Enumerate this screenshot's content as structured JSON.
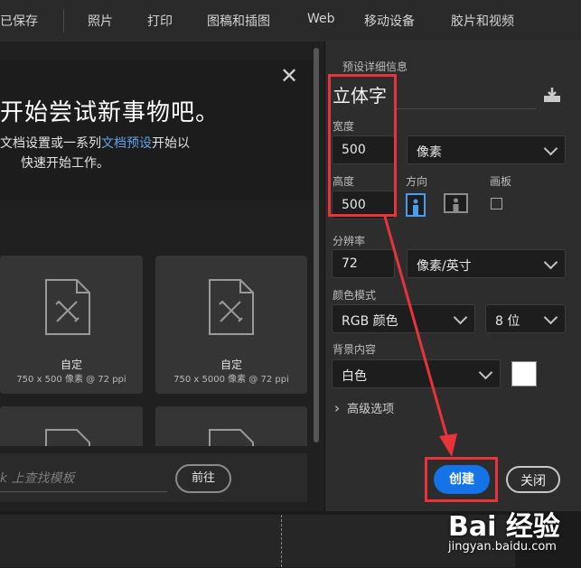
{
  "tabs": [
    "已保存",
    "照片",
    "打印",
    "图稿和插图",
    "Web",
    "移动设备",
    "胶片和视频"
  ],
  "intro": {
    "title": "开始尝试新事物吧。",
    "line1_pre": "文档设置或一系列",
    "line1_link": "文档预设",
    "line1_post": "开始以",
    "line2": "快速开始工作。"
  },
  "presets": [
    {
      "name": "自定",
      "size": "750 x 500 像素 @ 72 ppi"
    },
    {
      "name": "自定",
      "size": "750 x 5000 像素 @ 72 ppi"
    }
  ],
  "search": {
    "placeholder": "k 上查找模板",
    "go_label": "前往"
  },
  "details": {
    "section_title": "预设详细信息",
    "preset_name": "立体字",
    "width_label": "宽度",
    "width_value": "500",
    "unit_value": "像素",
    "height_label": "高度",
    "height_value": "500",
    "orientation_label": "方向",
    "artboard_label": "画板",
    "resolution_label": "分辨率",
    "resolution_value": "72",
    "resolution_unit": "像素/英寸",
    "color_mode_label": "颜色模式",
    "color_mode_value": "RGB 颜色",
    "bit_depth_value": "8 位",
    "background_label": "背景内容",
    "background_value": "白色",
    "advanced_label": "高级选项",
    "background_swatch": "#ffffff"
  },
  "actions": {
    "create_label": "创建",
    "close_label": "关闭"
  },
  "watermark": {
    "logo_text": "Bai 经验",
    "url": "jingyan.baidu.com"
  },
  "colors": {
    "accent": "#1473e6",
    "highlight": "#e8333b",
    "link": "#5fa3ea"
  }
}
